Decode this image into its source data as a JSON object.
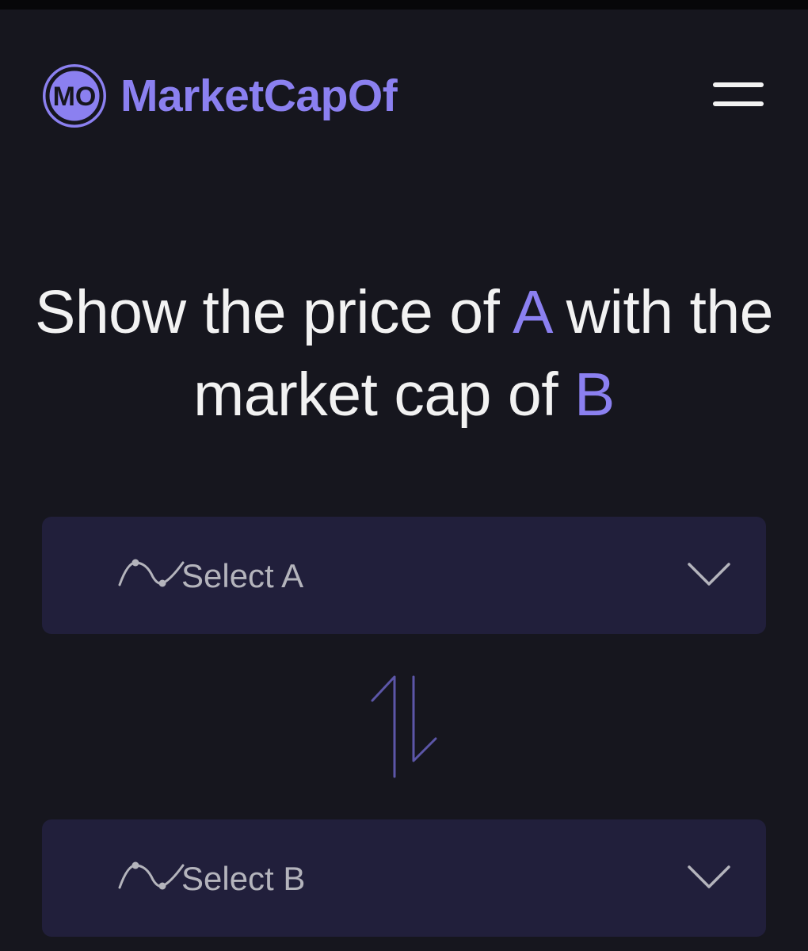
{
  "brand": {
    "logo_mark": "MO",
    "name": "MarketCapOf",
    "accent_color": "#8b80f0"
  },
  "header": {
    "menu_icon": "hamburger-menu-icon"
  },
  "headline": {
    "part1": "Show the price of",
    "token_a": "A",
    "part2": "with the market cap of",
    "token_b": "B"
  },
  "selectors": {
    "a": {
      "placeholder": "Select A",
      "icon": "trend-line-icon"
    },
    "b": {
      "placeholder": "Select B",
      "icon": "trend-line-icon"
    },
    "swap_icon": "swap-arrows-icon"
  },
  "colors": {
    "background": "#16161e",
    "select_bg": "#211f3b",
    "text": "#f2f2f2",
    "muted_text": "#b4b4bc"
  }
}
